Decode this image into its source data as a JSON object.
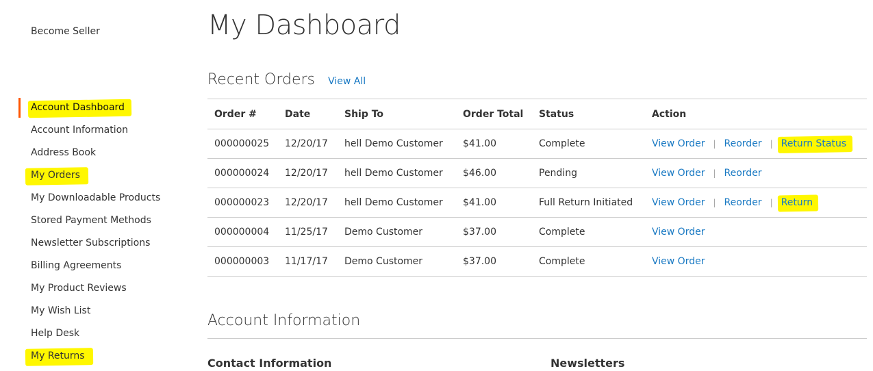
{
  "sidebar": {
    "become_seller": "Become Seller",
    "items": [
      {
        "label": "Account Dashboard",
        "current": true,
        "highlighted": true
      },
      {
        "label": "Account Information"
      },
      {
        "label": "Address Book"
      },
      {
        "label": "My Orders",
        "highlighted": true
      },
      {
        "label": "My Downloadable Products"
      },
      {
        "label": "Stored Payment Methods"
      },
      {
        "label": "Newsletter Subscriptions"
      },
      {
        "label": "Billing Agreements"
      },
      {
        "label": "My Product Reviews"
      },
      {
        "label": "My Wish List"
      },
      {
        "label": "Help Desk"
      },
      {
        "label": "My Returns",
        "highlighted": true
      }
    ]
  },
  "main": {
    "title": "My Dashboard",
    "recent_orders": {
      "title": "Recent Orders",
      "view_all": "View All",
      "columns": [
        "Order #",
        "Date",
        "Ship To",
        "Order Total",
        "Status",
        "Action"
      ],
      "rows": [
        {
          "order": "000000025",
          "date": "12/20/17",
          "ship_to": "hell Demo Customer",
          "total": "$41.00",
          "status": "Complete",
          "view": "View Order",
          "reorder": "Reorder",
          "extra": "Return Status"
        },
        {
          "order": "000000024",
          "date": "12/20/17",
          "ship_to": "hell Demo Customer",
          "total": "$46.00",
          "status": "Pending",
          "view": "View Order",
          "reorder": "Reorder",
          "extra": ""
        },
        {
          "order": "000000023",
          "date": "12/20/17",
          "ship_to": "hell Demo Customer",
          "total": "$41.00",
          "status": "Full Return Initiated",
          "view": "View Order",
          "reorder": "Reorder",
          "extra": "Return"
        },
        {
          "order": "000000004",
          "date": "11/25/17",
          "ship_to": "Demo Customer",
          "total": "$37.00",
          "status": "Complete",
          "view": "View Order",
          "reorder": "",
          "extra": ""
        },
        {
          "order": "000000003",
          "date": "11/17/17",
          "ship_to": "Demo Customer",
          "total": "$37.00",
          "status": "Complete",
          "view": "View Order",
          "reorder": "",
          "extra": ""
        }
      ],
      "separator": "|"
    },
    "account_information": {
      "title": "Account Information",
      "contact_title": "Contact Information",
      "newsletters_title": "Newsletters"
    }
  },
  "colors": {
    "link": "#1979c3",
    "highlight": "#fff700",
    "active_marker": "#ff5501",
    "border": "#cccccc"
  }
}
